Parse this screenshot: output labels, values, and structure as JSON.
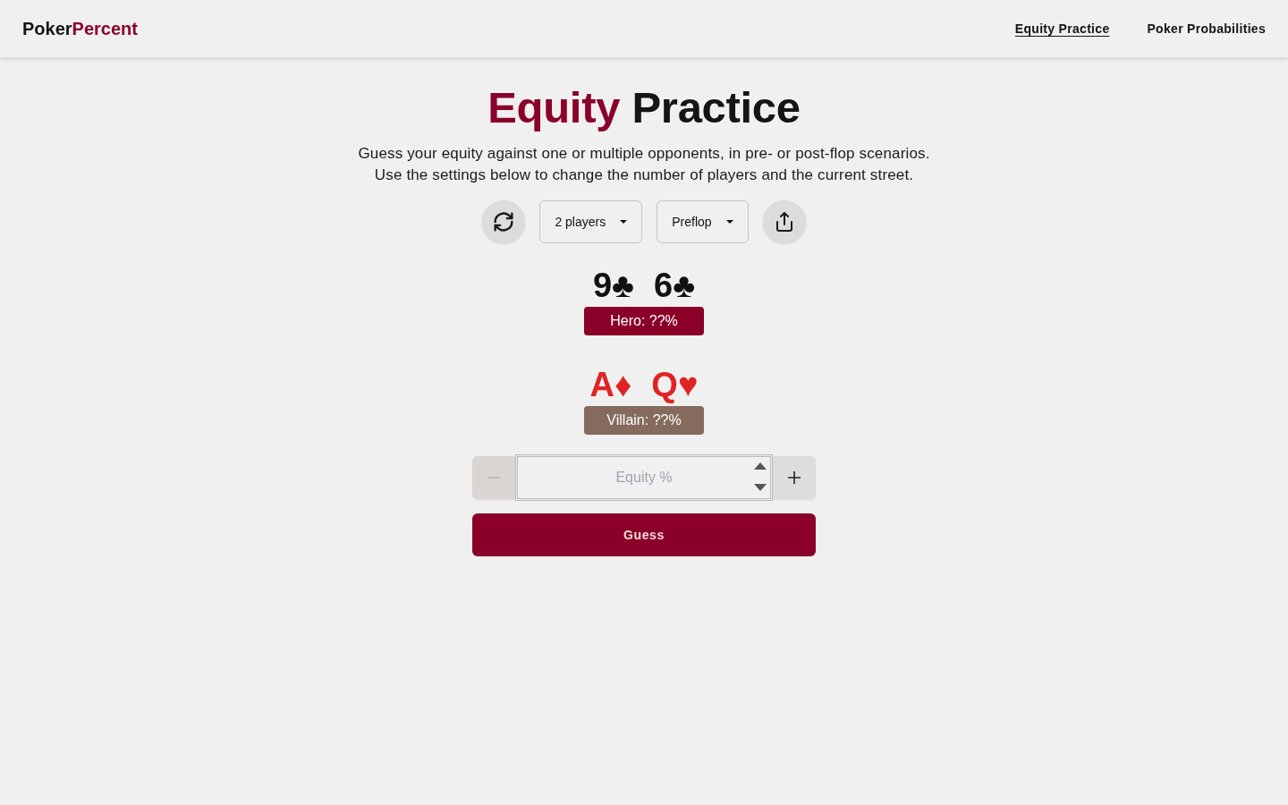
{
  "header": {
    "brand": [
      {
        "text": "Poker",
        "kind": "plain"
      },
      {
        "text": "Percent",
        "kind": "accent"
      }
    ],
    "nav": [
      {
        "label": "Equity Practice",
        "selected": true
      },
      {
        "label": "Poker Probabilities",
        "selected": false
      }
    ]
  },
  "title": [
    {
      "text": "Equity",
      "kind": "accent"
    },
    {
      "text": "Practice",
      "kind": "plain"
    }
  ],
  "description": [
    "Guess your equity against one or multiple opponents, in pre- or post-flop scenarios.",
    "Use the settings below to change the number of players and the current street."
  ],
  "settings": {
    "players": "2 players",
    "street": "Preflop"
  },
  "hands": [
    {
      "cards": [
        {
          "text": "9♣",
          "color": "#111111"
        },
        {
          "text": "6♣",
          "color": "#111111"
        }
      ],
      "label": "Hero: ??%",
      "color": "#8b0029"
    },
    {
      "cards": [
        {
          "text": "A♦",
          "color": "#e02424"
        },
        {
          "text": "Q♥",
          "color": "#e02424"
        }
      ],
      "label": "Villain: ??%",
      "color": "#846b5d"
    }
  ],
  "equity_input": {
    "placeholder": "Equity %",
    "decrement": {
      "disabled": true
    },
    "increment": {
      "disabled": false
    }
  },
  "guess_button": "Guess"
}
